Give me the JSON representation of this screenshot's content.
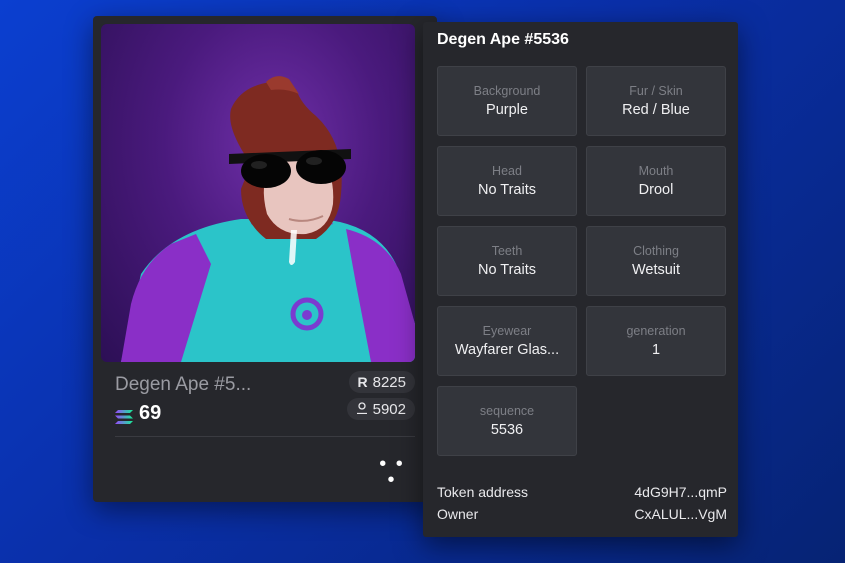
{
  "card": {
    "name": "Degen Ape #5...",
    "price": "69",
    "rank": "8225",
    "number": "5902",
    "more_label": "• • •"
  },
  "detail": {
    "title": "Degen Ape #5536",
    "traits": [
      {
        "label": "Background",
        "value": "Purple"
      },
      {
        "label": "Fur / Skin",
        "value": "Red / Blue"
      },
      {
        "label": "Head",
        "value": "No Traits"
      },
      {
        "label": "Mouth",
        "value": "Drool"
      },
      {
        "label": "Teeth",
        "value": "No Traits"
      },
      {
        "label": "Clothing",
        "value": "Wetsuit"
      },
      {
        "label": "Eyewear",
        "value": "Wayfarer Glas..."
      },
      {
        "label": "generation",
        "value": "1"
      },
      {
        "label": "sequence",
        "value": "5536"
      }
    ],
    "token_address_label": "Token address",
    "token_address_value": "4dG9H7...qmP",
    "owner_label": "Owner",
    "owner_value": "CxALUL...VgM"
  },
  "icons": {
    "price": "solana-icon",
    "rank": "rank-icon",
    "number": "owner-icon"
  },
  "colors": {
    "background": "#0a2fa8",
    "card": "#26272c",
    "tile": "#33353b",
    "image_bg": "#4a1a7d"
  }
}
